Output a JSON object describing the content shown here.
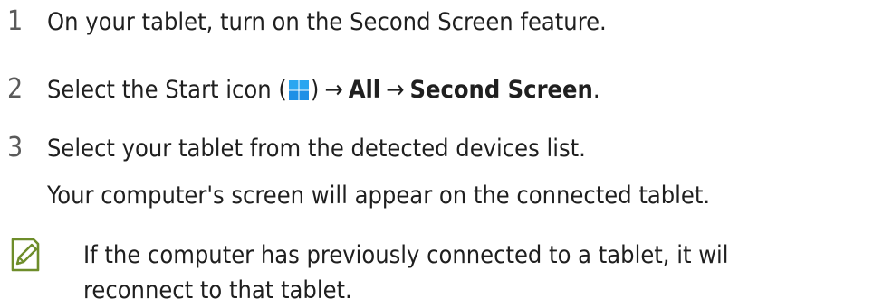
{
  "steps": [
    {
      "number": "1",
      "text": "On your tablet, turn on the Second Screen feature."
    },
    {
      "number": "2",
      "prefix": "Select the Start icon (",
      "suffix": ")",
      "arrow": "→",
      "all_label": "All",
      "second_screen_label": "Second Screen",
      "period": "."
    },
    {
      "number": "3",
      "text": "Select your tablet from the detected devices list.",
      "subtext": "Your computer's screen will appear on the connected tablet."
    }
  ],
  "note": {
    "icon": "note-pencil-icon",
    "line1": "If the computer has previously connected to a tablet, it wil",
    "line2": "reconnect to that tablet."
  },
  "colors": {
    "text": "#1f1f1f",
    "note_icon": "#6e8d2a",
    "windows_blue": "#1e8fe6"
  }
}
